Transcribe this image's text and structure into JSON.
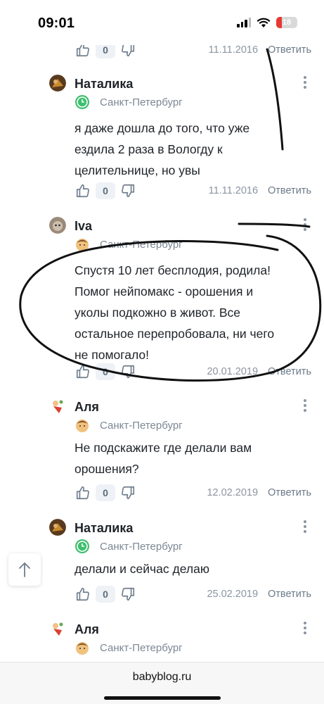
{
  "status_bar": {
    "time": "09:01",
    "battery": "18"
  },
  "actions": {
    "reply_label": "Ответить"
  },
  "top_partial": {
    "score": "0",
    "date": "11.11.2016"
  },
  "comments": [
    {
      "author": "Наталика",
      "city": "Санкт-Петербург",
      "text_lines": [
        "я даже дошла до того, что уже",
        "ездила 2 раза в Вологду к",
        "целительнице, но увы"
      ],
      "score": "0",
      "date": "11.11.2016"
    },
    {
      "author": "Iva",
      "city": "Санкт-Петербург",
      "text_lines": [
        "Спустя 10 лет бесплодия, родила!",
        "Помог нейпомакс - орошения и",
        "уколы подкожно в живот. Все",
        "остальное перепробовала, ни чего",
        "не помогало!"
      ],
      "score": "0",
      "date": "20.01.2019"
    },
    {
      "author": "Аля",
      "city": "Санкт-Петербург",
      "text_lines": [
        "Не подскажите где делали вам",
        "орошения?"
      ],
      "score": "0",
      "date": "12.02.2019"
    },
    {
      "author": "Наталика",
      "city": "Санкт-Петербург",
      "text_lines": [
        "делали и сейчас делаю"
      ],
      "score": "0",
      "date": "25.02.2019"
    },
    {
      "author": "Аля",
      "city": "Санкт-Петербург"
    }
  ],
  "browser": {
    "url": "babyblog.ru"
  },
  "icons": {
    "like": "thumbs-up-icon",
    "dislike": "thumbs-down-icon",
    "menu": "more-vertical-icon",
    "scroll_top": "arrow-up-icon",
    "location_green": "clock-badge-icon",
    "location_face": "face-badge-icon"
  },
  "colors": {
    "accent_green": "#3fbf6f",
    "meta_gray": "#8a95a1",
    "battery_red": "#e53935"
  }
}
